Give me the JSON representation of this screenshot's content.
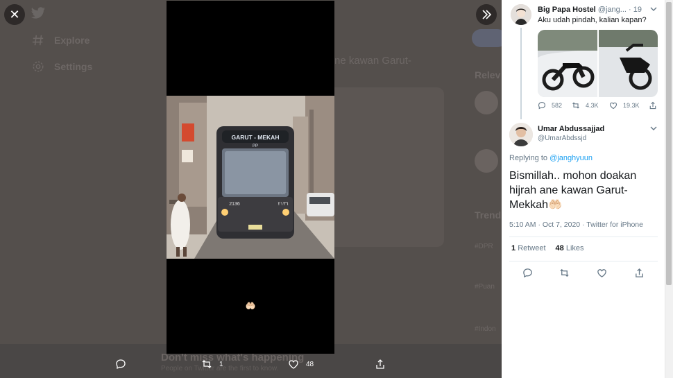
{
  "viewer": {
    "close_label": "✕",
    "photo_sign": "GARUT - MEKAH",
    "photo_sign_sub": "PP",
    "photo_plate_left": "2136",
    "photo_plate_right": "٢١٣٦",
    "emoji": "🤲🏻",
    "actions": {
      "retweets": "1",
      "likes": "48"
    }
  },
  "background": {
    "nav": [
      {
        "label": "Explore",
        "icon": "hash-icon"
      },
      {
        "label": "Settings",
        "icon": "gear-icon"
      }
    ],
    "fragment": "ne kawan Garut-",
    "sidebar": {
      "relevant_title": "Relev",
      "trends_title": "Trend",
      "tags": [
        "#DPR",
        "#Puan",
        "#Indon"
      ]
    },
    "bottom_title": "Don't miss what's happening",
    "bottom_sub": "People on Twitter are the first to know."
  },
  "thread": {
    "tweet1": {
      "name": "Big Papa Hostel",
      "handle": "@jang...",
      "sep": "·",
      "time": "19h",
      "text": "Aku udah pindah, kalian kapan?",
      "replies": "582",
      "retweets": "4.3K",
      "likes": "19.3K"
    },
    "tweet2": {
      "name": "Umar Abdussajjad",
      "handle": "@UmarAbdssjd",
      "replying_prefix": "Replying to ",
      "replying_handle": "@janghyuun",
      "text": "Bismillah.. mohon doakan hijrah ane kawan Garut-Mekkah🤲🏻",
      "meta": "5:10 AM · Oct 7, 2020 · Twitter for iPhone",
      "retweet_count": "1",
      "retweet_label": "Retweet",
      "like_count": "48",
      "like_label": "Likes"
    }
  },
  "colors": {
    "accent": "#1da1f2",
    "muted": "#657786",
    "overlay": "#544f4c"
  }
}
